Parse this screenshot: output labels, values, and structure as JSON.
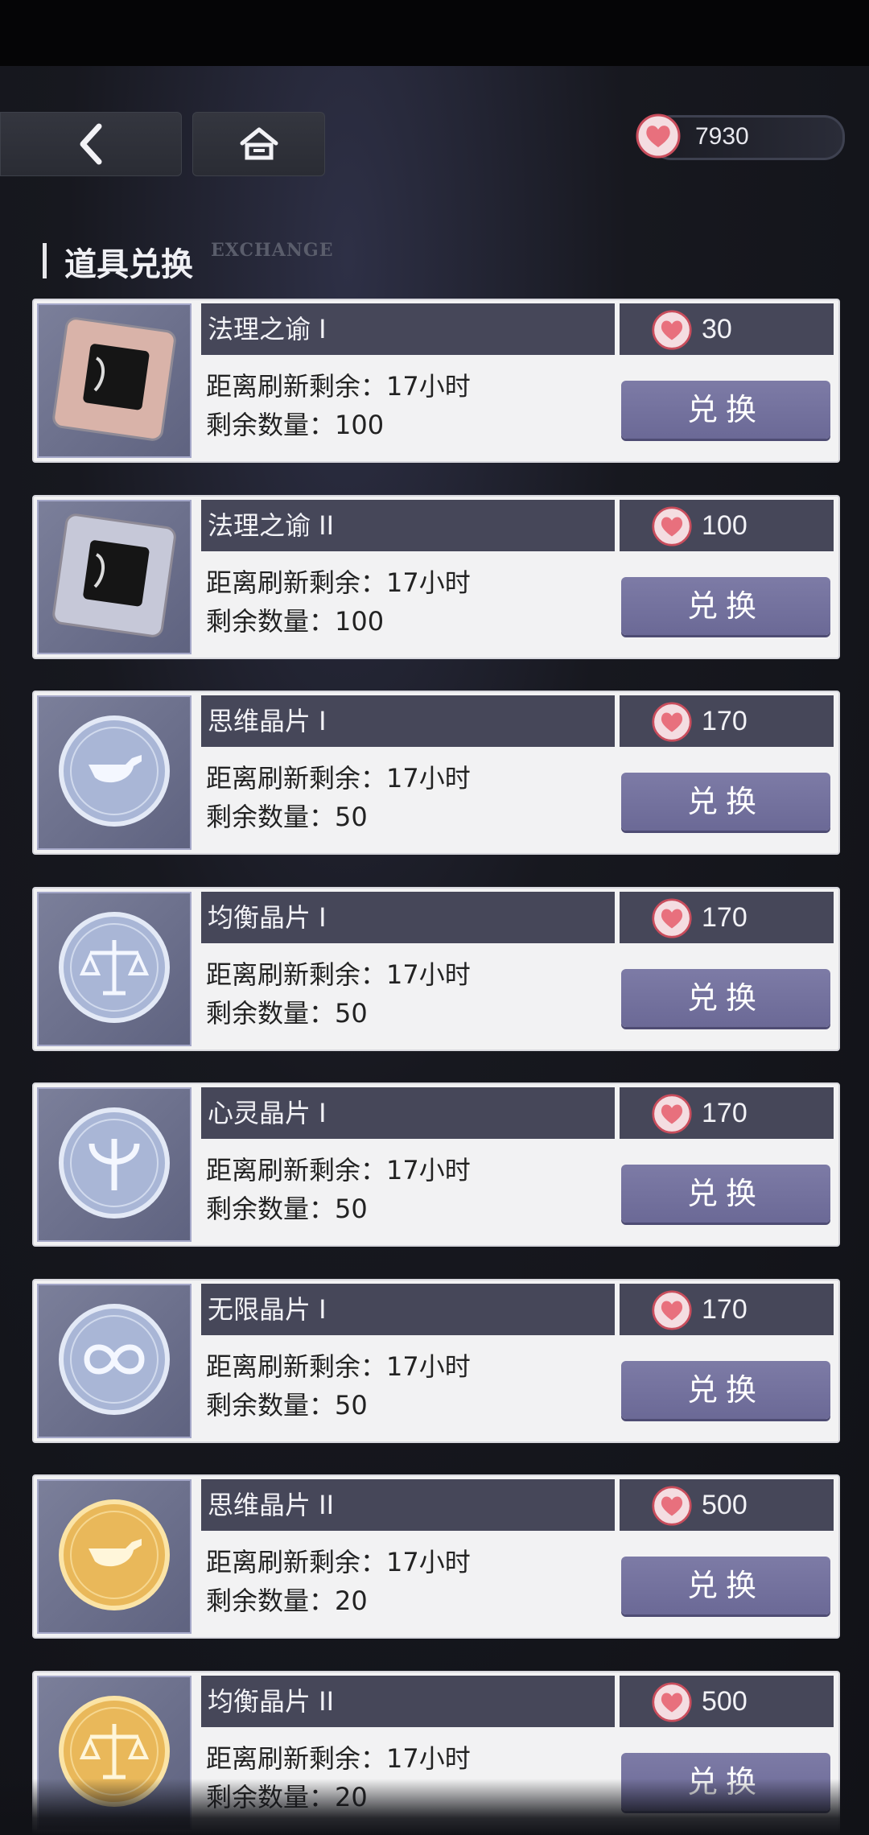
{
  "colors": {
    "accent": "#6b6996",
    "bar": "#464759",
    "heart": "#e8707d"
  },
  "header": {
    "back_icon": "chevron-left-icon",
    "home_icon": "home-icon",
    "currency_icon": "heart-icon",
    "currency_value": "7930"
  },
  "section": {
    "title": "道具兑换",
    "subtitle": "EXCHANGE"
  },
  "items": [
    {
      "name": "法理之谕 I",
      "price": "30",
      "refresh": "距离刷新剩余：17小时",
      "remaining": "剩余数量：100",
      "button": "兑换",
      "icon": "tablet-bronze-icon"
    },
    {
      "name": "法理之谕 II",
      "price": "100",
      "refresh": "距离刷新剩余：17小时",
      "remaining": "剩余数量：100",
      "button": "兑换",
      "icon": "tablet-silver-icon"
    },
    {
      "name": "思维晶片 I",
      "price": "170",
      "refresh": "距离刷新剩余：17小时",
      "remaining": "剩余数量：50",
      "button": "兑换",
      "icon": "pipe-chip-silver-icon"
    },
    {
      "name": "均衡晶片 I",
      "price": "170",
      "refresh": "距离刷新剩余：17小时",
      "remaining": "剩余数量：50",
      "button": "兑换",
      "icon": "scales-chip-silver-icon"
    },
    {
      "name": "心灵晶片 I",
      "price": "170",
      "refresh": "距离刷新剩余：17小时",
      "remaining": "剩余数量：50",
      "button": "兑换",
      "icon": "psi-chip-silver-icon"
    },
    {
      "name": "无限晶片 I",
      "price": "170",
      "refresh": "距离刷新剩余：17小时",
      "remaining": "剩余数量：50",
      "button": "兑换",
      "icon": "infinity-chip-silver-icon"
    },
    {
      "name": "思维晶片 II",
      "price": "500",
      "refresh": "距离刷新剩余：17小时",
      "remaining": "剩余数量：20",
      "button": "兑换",
      "icon": "pipe-chip-gold-icon"
    },
    {
      "name": "均衡晶片 II",
      "price": "500",
      "refresh": "距离刷新剩余：17小时",
      "remaining": "剩余数量：20",
      "button": "兑换",
      "icon": "scales-chip-gold-icon"
    }
  ]
}
